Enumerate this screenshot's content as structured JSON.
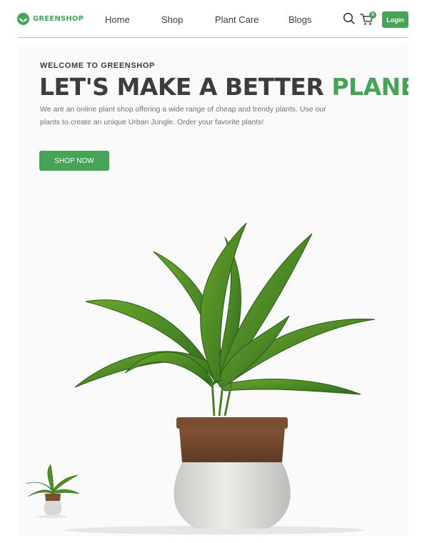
{
  "brand": {
    "name": "GREENSHOP",
    "color": "#46a358"
  },
  "nav": [
    {
      "label": "Home"
    },
    {
      "label": "Shop"
    },
    {
      "label": "Plant Care"
    },
    {
      "label": "Blogs"
    }
  ],
  "header": {
    "search_icon": "search-icon",
    "cart_icon": "cart-icon",
    "cart_count": "6",
    "login_label": "Login"
  },
  "hero": {
    "eyebrow": "WELCOME TO GREENSHOP",
    "title_main": "LET'S MAKE A BETTER ",
    "title_accent": "PLANET",
    "description": "We are an online plant shop offering a wide range of cheap and trendy plants. Use our plants to create an unique Urban Jungle. Order your favorite plants!",
    "cta_label": "SHOP NOW"
  },
  "colors": {
    "accent": "#46a358",
    "text": "#3d3d3d",
    "muted": "#727272",
    "hero_bg": "#fafafa"
  }
}
